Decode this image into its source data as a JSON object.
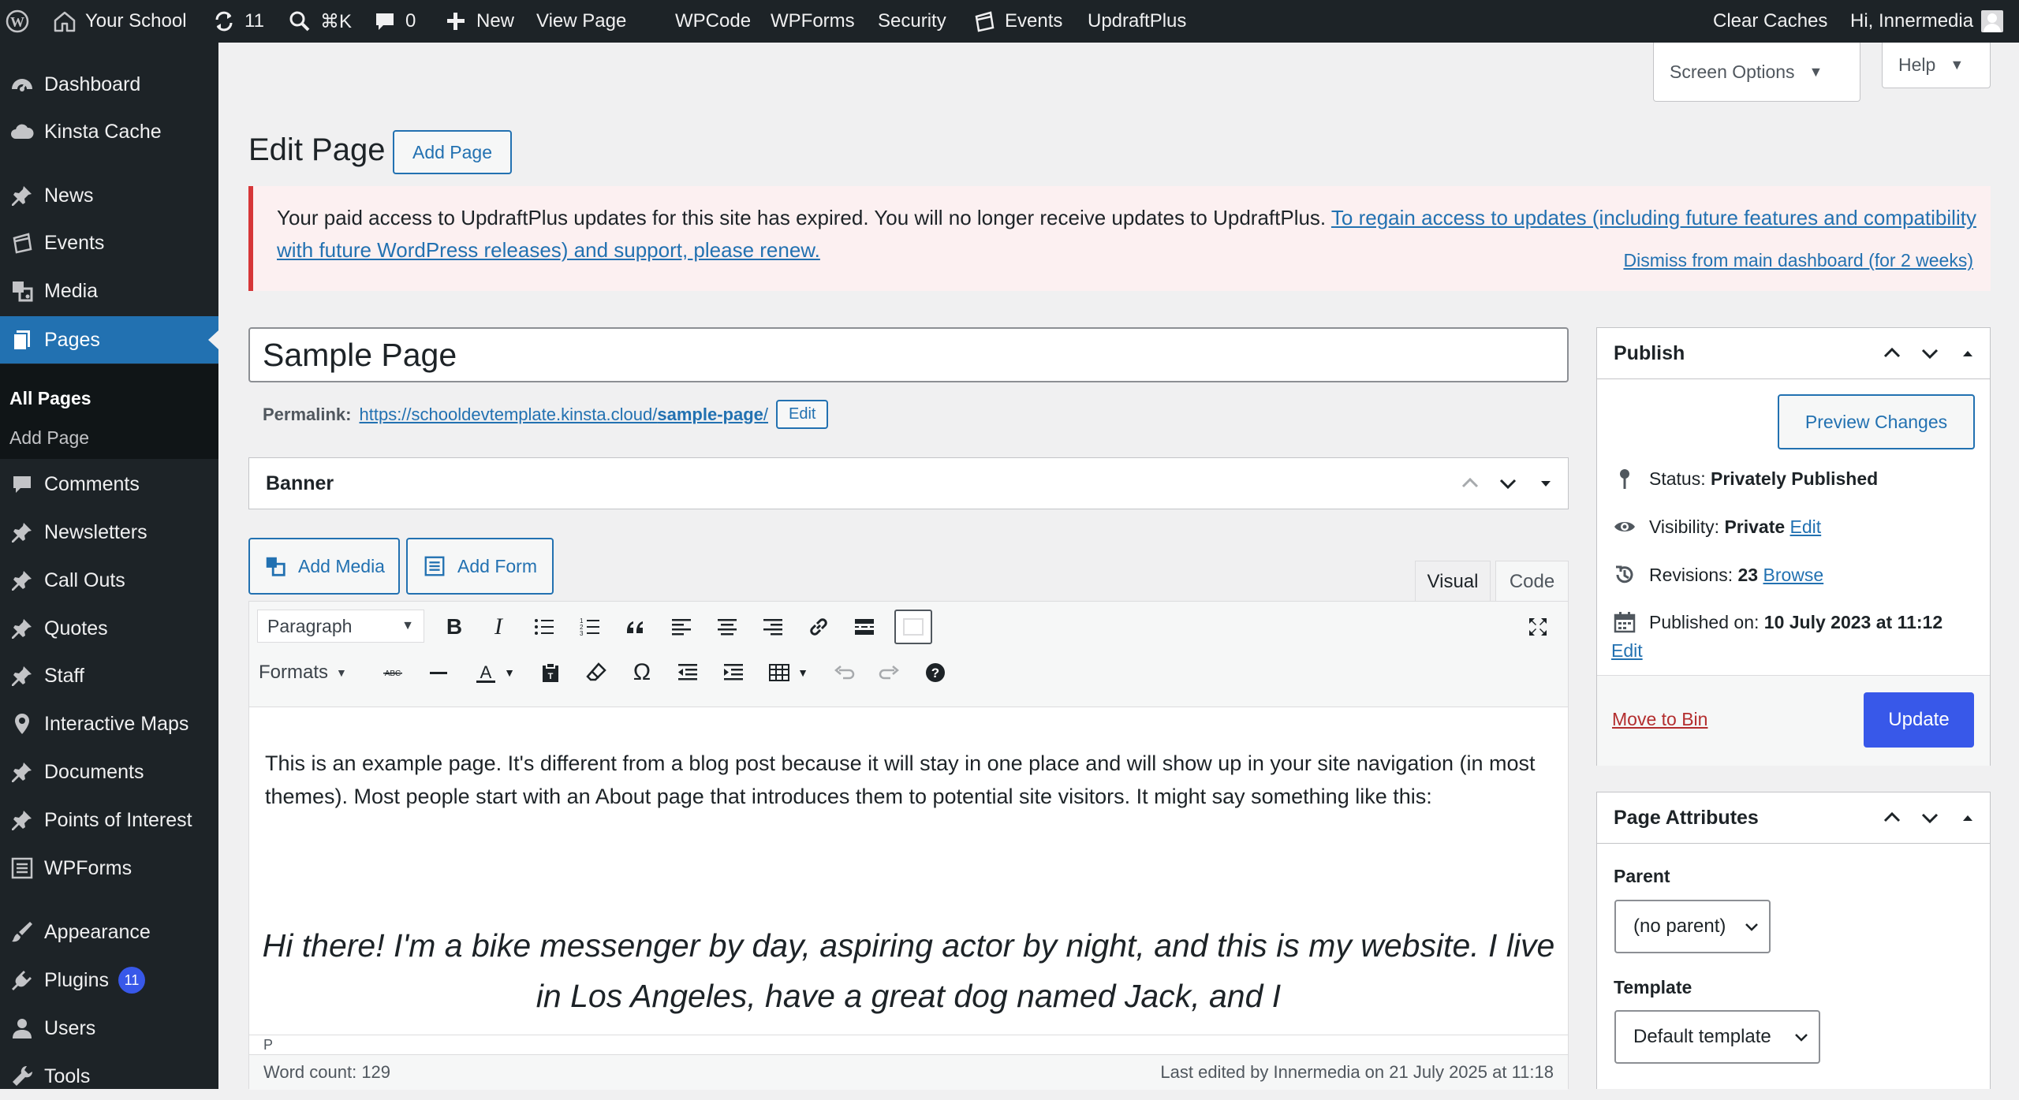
{
  "admin_bar": {
    "site_name": "Your School",
    "updates_count": "11",
    "search_shortcut": "⌘K",
    "comments_count": "0",
    "new_label": "New",
    "view_page": "View Page",
    "wpcode": "WPCode",
    "wpforms": "WPForms",
    "security": "Security",
    "events": "Events",
    "updraftplus": "UpdraftPlus",
    "clear_caches": "Clear Caches",
    "greeting": "Hi, Innermedia"
  },
  "sidebar": {
    "items": [
      {
        "label": "Dashboard",
        "icon": "dashboard-icon"
      },
      {
        "label": "Kinsta Cache",
        "icon": "cloud-icon"
      },
      {
        "label": "News",
        "icon": "pin-icon"
      },
      {
        "label": "Events",
        "icon": "events-icon"
      },
      {
        "label": "Media",
        "icon": "media-icon"
      },
      {
        "label": "Pages",
        "icon": "pages-icon",
        "current": true
      },
      {
        "label": "Comments",
        "icon": "comment-icon"
      },
      {
        "label": "Newsletters",
        "icon": "pin-icon"
      },
      {
        "label": "Call Outs",
        "icon": "pin-icon"
      },
      {
        "label": "Quotes",
        "icon": "pin-icon"
      },
      {
        "label": "Staff",
        "icon": "pin-icon"
      },
      {
        "label": "Interactive Maps",
        "icon": "location-icon"
      },
      {
        "label": "Documents",
        "icon": "pin-icon"
      },
      {
        "label": "Points of Interest",
        "icon": "pin-icon"
      },
      {
        "label": "WPForms",
        "icon": "form-icon"
      },
      {
        "label": "Appearance",
        "icon": "brush-icon"
      },
      {
        "label": "Plugins",
        "icon": "plugin-icon",
        "badge": "11"
      },
      {
        "label": "Users",
        "icon": "user-icon"
      },
      {
        "label": "Tools",
        "icon": "wrench-icon"
      }
    ],
    "submenu": [
      {
        "label": "All Pages",
        "current": true
      },
      {
        "label": "Add Page"
      }
    ]
  },
  "screen_meta": {
    "screen_options": "Screen Options",
    "help": "Help"
  },
  "heading": {
    "title": "Edit Page",
    "add_button": "Add Page"
  },
  "notice": {
    "text": "Your paid access to UpdraftPlus updates for this site has expired. You will no longer receive updates to UpdraftPlus.",
    "renew_link": "To regain access to updates (including future features and compatibility with future WordPress releases) and support, please renew.",
    "dismiss_link": "Dismiss from main dashboard (for 2 weeks)"
  },
  "post": {
    "title": "Sample Page",
    "permalink_label": "Permalink:",
    "permalink_base": "https://schooldevtemplate.kinsta.cloud/",
    "permalink_slug": "sample-page",
    "permalink_trailing": "/",
    "permalink_edit": "Edit"
  },
  "banner_box": {
    "title": "Banner"
  },
  "editor": {
    "add_media": "Add Media",
    "add_form": "Add Form",
    "tab_visual": "Visual",
    "tab_code": "Code",
    "format_select": "Paragraph",
    "formats_menu": "Formats",
    "paragraph": "This is an example page. It's different from a blog post because it will stay in one place and will show up in your site navigation (in most themes). Most people start with an About page that introduces them to potential site visitors. It might say something like this:",
    "quote": "Hi there! I'm a bike messenger by day, aspiring actor by night, and this is my website. I live in Los Angeles, have a great dog named Jack, and I",
    "path": "P",
    "word_count": "Word count: 129",
    "last_edited": "Last edited by Innermedia on 21 July 2025 at 11:18"
  },
  "publish": {
    "title": "Publish",
    "preview_button": "Preview Changes",
    "status_label": "Status:",
    "status_value": "Privately Published",
    "visibility_label": "Visibility:",
    "visibility_value": "Private",
    "visibility_edit": "Edit",
    "revisions_label": "Revisions:",
    "revisions_value": "23",
    "revisions_browse": "Browse",
    "published_label": "Published on:",
    "published_value": "10 July 2023 at 11:12",
    "published_edit": "Edit",
    "move_to_bin": "Move to Bin",
    "update_button": "Update"
  },
  "page_attributes": {
    "title": "Page Attributes",
    "parent_label": "Parent",
    "parent_value": "(no parent)",
    "template_label": "Template",
    "template_value": "Default template"
  }
}
